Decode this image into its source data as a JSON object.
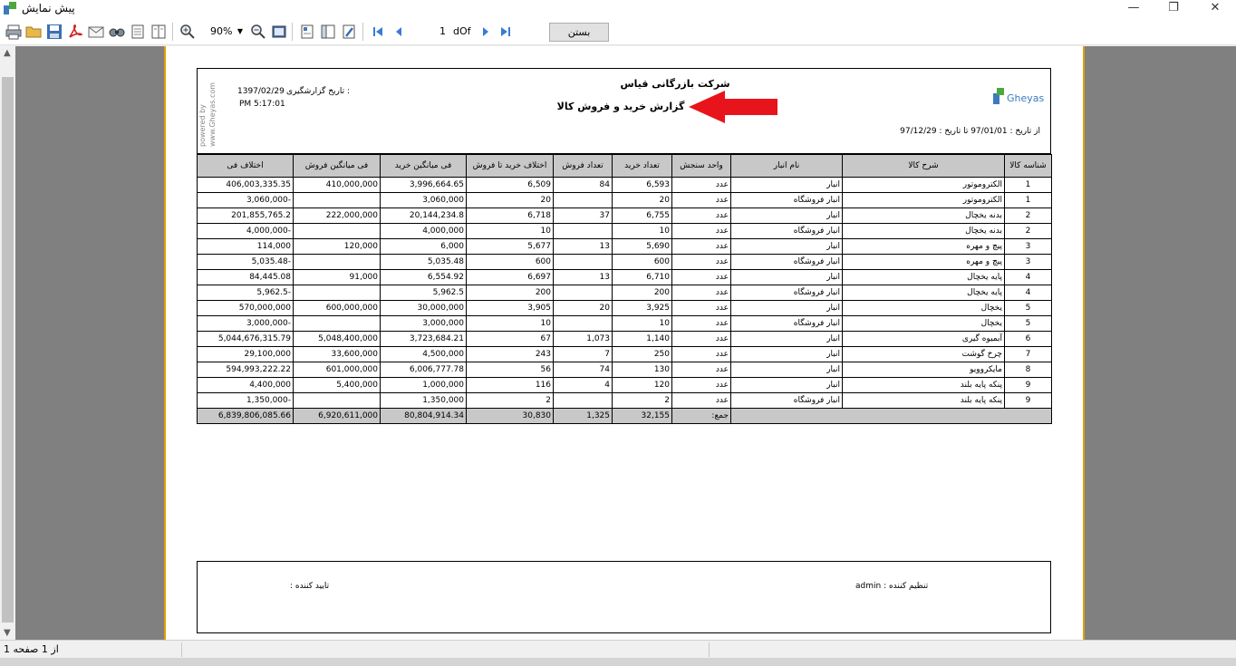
{
  "window": {
    "title": "پیش نمایش"
  },
  "toolbar": {
    "zoom_value": "90%",
    "page_input": "1",
    "page_of": "dOf",
    "close_label": "بستن"
  },
  "report": {
    "company": "شرکت بازرگانی قیاس",
    "title": "گزارش خرید و فروش کالا",
    "date_label": "تاریخ گزارشگیری :",
    "date_value": "1397/02/29",
    "time_value": "PM 5:17:01",
    "powered_line1": "powered by",
    "powered_line2": "www.Gheyas.com",
    "logo_text": "Gheyas",
    "range_text": "از تاریخ : 97/01/01   تا تاریخ : 97/12/29",
    "columns": [
      "شناسه کالا",
      "شرح کالا",
      "نام انبار",
      "واحد سنجش",
      "تعداد خرید",
      "تعداد فروش",
      "اختلاف خرید تا فروش",
      "فی میانگین خرید",
      "فی میانگین فروش",
      "اختلاف فی"
    ],
    "rows": [
      [
        "1",
        "الکتروموتور",
        "انبار",
        "عدد",
        "6,593",
        "84",
        "6,509",
        "3,996,664.65",
        "410,000,000",
        "406,003,335.35"
      ],
      [
        "1",
        "الکتروموتور",
        "انبار فروشگاه",
        "عدد",
        "20",
        "",
        "20",
        "3,060,000",
        "",
        "3,060,000-"
      ],
      [
        "2",
        "بدنه یخچال",
        "انبار",
        "عدد",
        "6,755",
        "37",
        "6,718",
        "20,144,234.8",
        "222,000,000",
        "201,855,765.2"
      ],
      [
        "2",
        "بدنه یخچال",
        "انبار فروشگاه",
        "عدد",
        "10",
        "",
        "10",
        "4,000,000",
        "",
        "4,000,000-"
      ],
      [
        "3",
        "پیچ و مهره",
        "انبار",
        "عدد",
        "5,690",
        "13",
        "5,677",
        "6,000",
        "120,000",
        "114,000"
      ],
      [
        "3",
        "پیچ و مهره",
        "انبار فروشگاه",
        "عدد",
        "600",
        "",
        "600",
        "5,035.48",
        "",
        "5,035.48-"
      ],
      [
        "4",
        "پایه یخچال",
        "انبار",
        "عدد",
        "6,710",
        "13",
        "6,697",
        "6,554.92",
        "91,000",
        "84,445.08"
      ],
      [
        "4",
        "پایه یخچال",
        "انبار فروشگاه",
        "عدد",
        "200",
        "",
        "200",
        "5,962.5",
        "",
        "5,962.5-"
      ],
      [
        "5",
        "یخچال",
        "انبار",
        "عدد",
        "3,925",
        "20",
        "3,905",
        "30,000,000",
        "600,000,000",
        "570,000,000"
      ],
      [
        "5",
        "یخچال",
        "انبار فروشگاه",
        "عدد",
        "10",
        "",
        "10",
        "3,000,000",
        "",
        "3,000,000-"
      ],
      [
        "6",
        "آبمیوه گیری",
        "انبار",
        "عدد",
        "1,140",
        "1,073",
        "67",
        "3,723,684.21",
        "5,048,400,000",
        "5,044,676,315.79"
      ],
      [
        "7",
        "چرخ گوشت",
        "انبار",
        "عدد",
        "250",
        "7",
        "243",
        "4,500,000",
        "33,600,000",
        "29,100,000"
      ],
      [
        "8",
        "مایکروویو",
        "انبار",
        "عدد",
        "130",
        "74",
        "56",
        "6,006,777.78",
        "601,000,000",
        "594,993,222.22"
      ],
      [
        "9",
        "پنکه پایه بلند",
        "انبار",
        "عدد",
        "120",
        "4",
        "116",
        "1,000,000",
        "5,400,000",
        "4,400,000"
      ],
      [
        "9",
        "پنکه پایه بلند",
        "انبار فروشگاه",
        "عدد",
        "2",
        "",
        "2",
        "1,350,000",
        "",
        "1,350,000-"
      ]
    ],
    "total_label": "جمع:",
    "totals": {
      "buy_qty": "32,155",
      "sell_qty": "1,325",
      "diff_qty": "30,830",
      "avg_buy": "80,804,914.34",
      "avg_sell": "6,920,611,000",
      "diff_price": "6,839,806,085.66"
    },
    "preparer_label": "تنظیم کننده : admin",
    "approver_label": "تایید کننده :"
  },
  "status": {
    "page_text": "از 1 صفحه 1"
  },
  "colors": {
    "header_bg": "#c8c8c8",
    "page_border": "#e0a000",
    "arrow": "#e8141b",
    "logo_green": "#4aa83c",
    "logo_blue": "#3a7bbf"
  },
  "icons": [
    "print-icon",
    "open-icon",
    "save-icon",
    "pdf-icon",
    "email-icon",
    "find-icon",
    "single-page-icon",
    "multi-page-icon",
    "zoom-in-icon",
    "zoom-out-icon",
    "fit-page-icon",
    "thumbnails-icon",
    "outline-icon",
    "settings-icon",
    "first-page-icon",
    "prev-page-icon",
    "next-page-icon",
    "last-page-icon"
  ]
}
